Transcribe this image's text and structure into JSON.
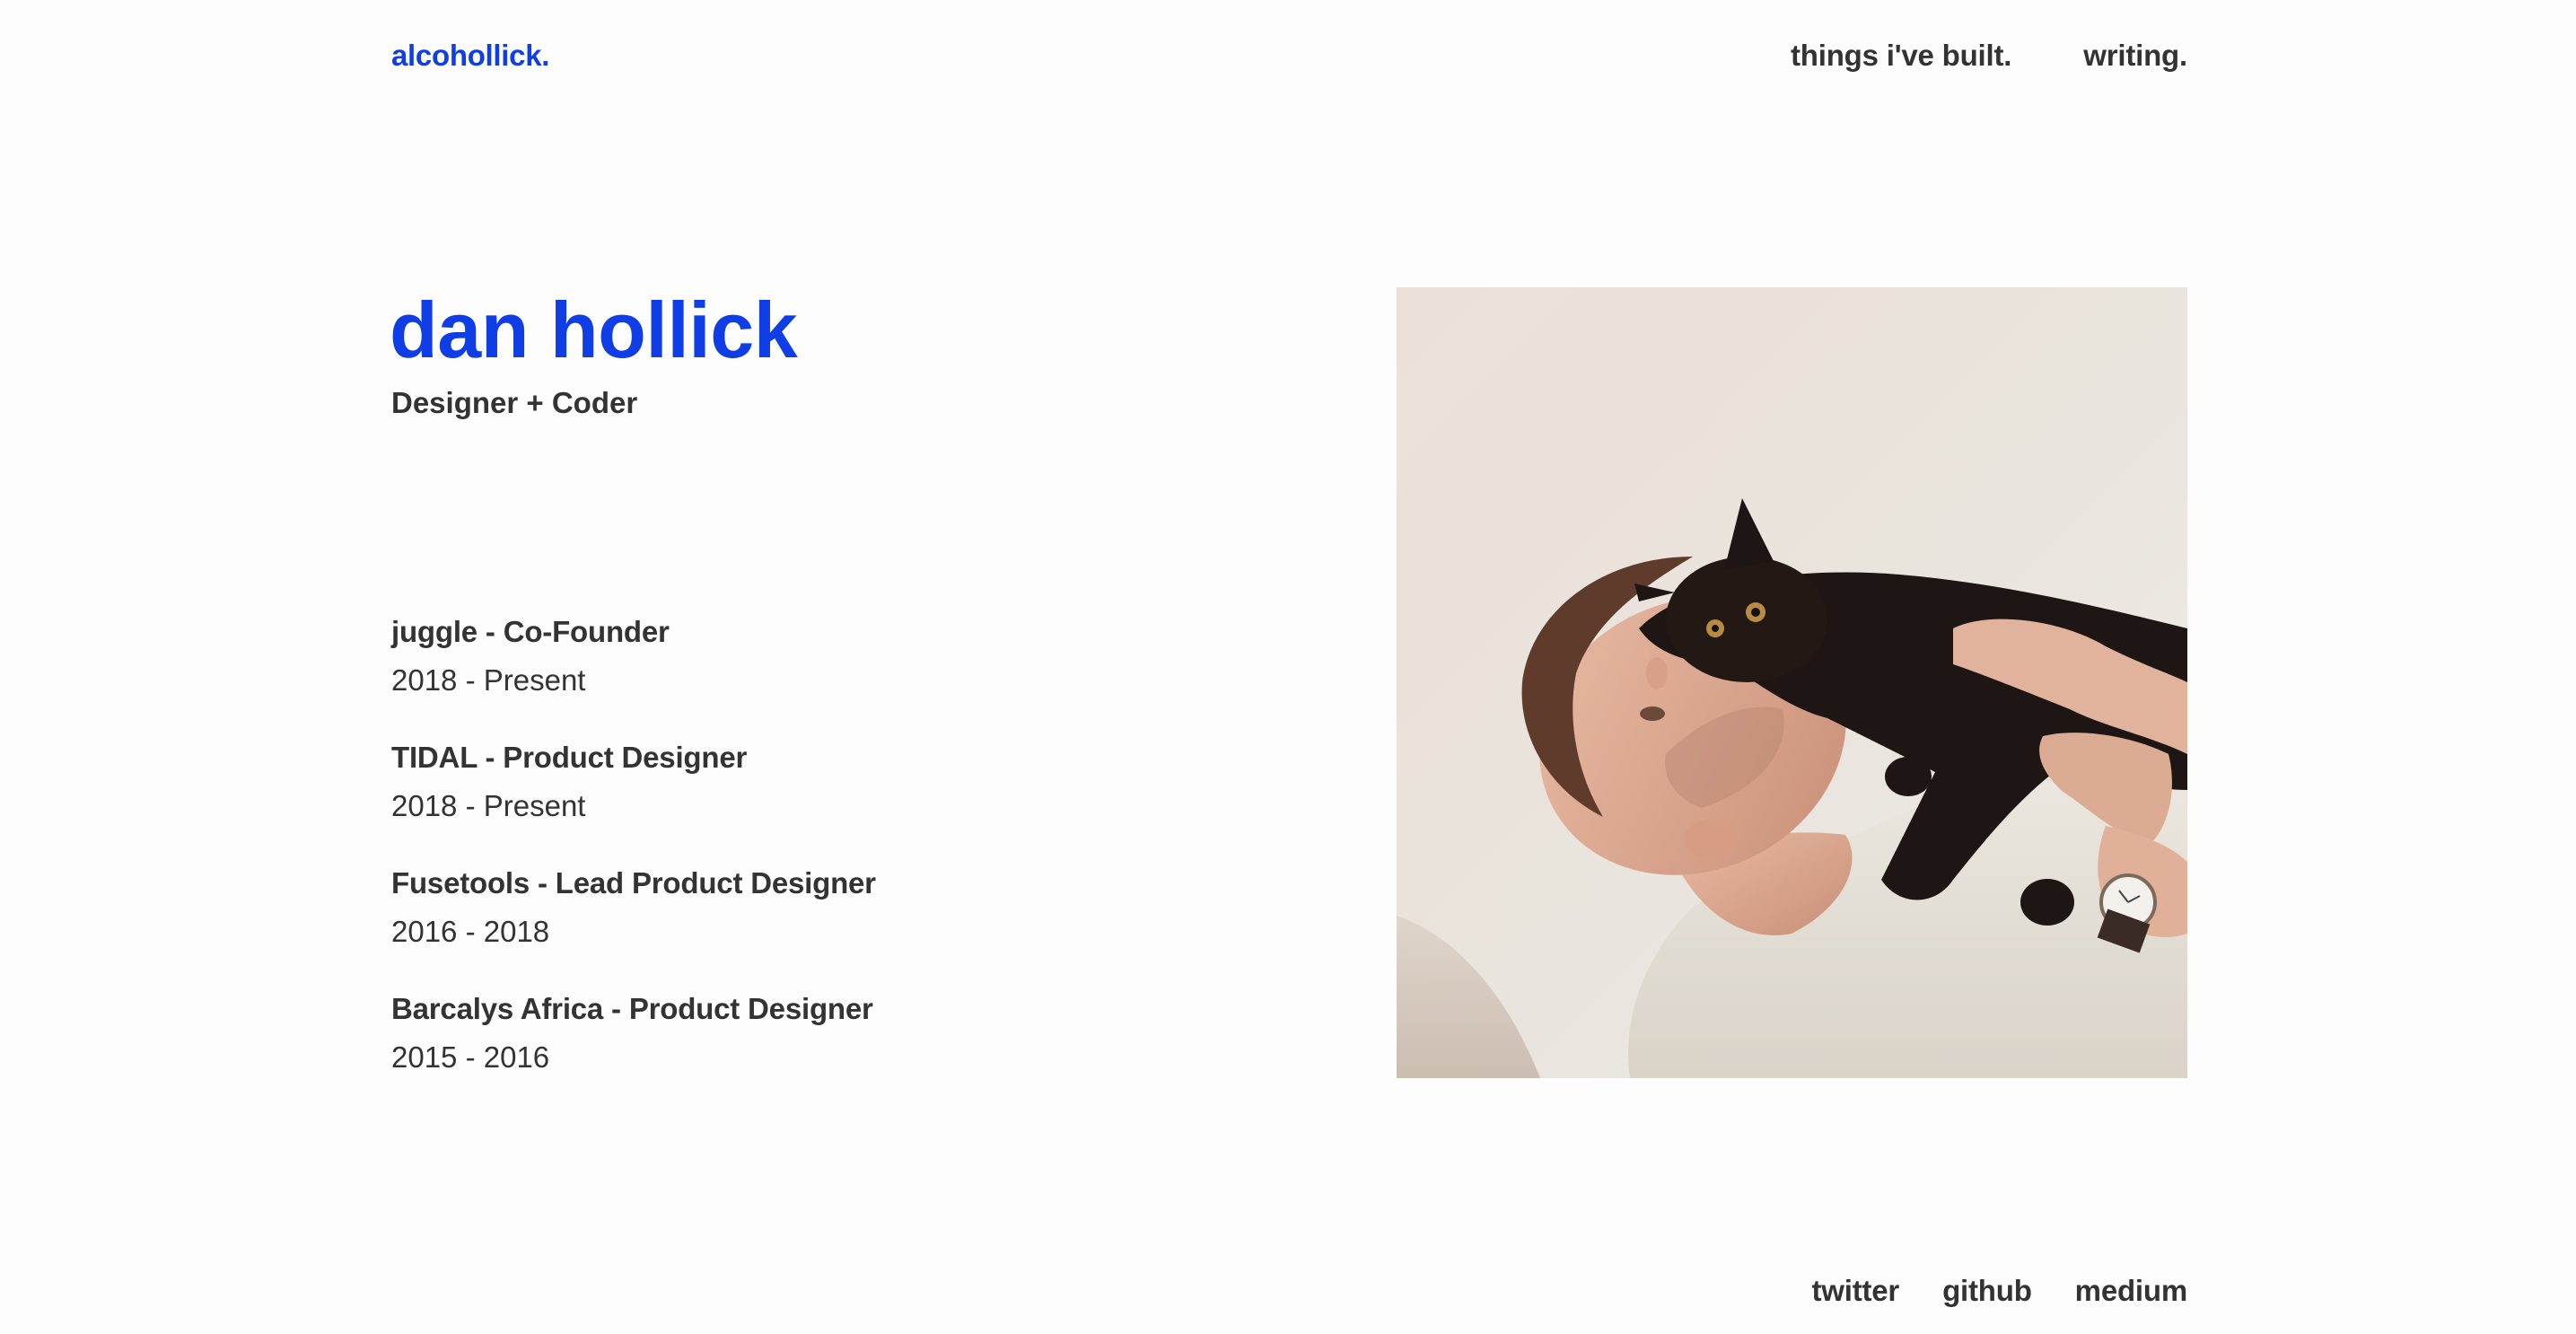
{
  "header": {
    "logo": "alcohollick.",
    "nav": [
      {
        "label": "things i've built."
      },
      {
        "label": "writing."
      }
    ]
  },
  "hero": {
    "name": "dan hollick",
    "tagline": "Designer + Coder",
    "photo_icon": "portrait-with-black-cat-image"
  },
  "jobs": [
    {
      "title": "juggle - Co-Founder",
      "dates": "2018 - Present"
    },
    {
      "title": "TIDAL - Product Designer",
      "dates": "2018 - Present"
    },
    {
      "title": "Fusetools - Lead Product Designer",
      "dates": "2016 - 2018"
    },
    {
      "title": "Barcalys Africa - Product Designer",
      "dates": "2015 - 2016"
    }
  ],
  "footer": {
    "links": [
      {
        "label": "twitter"
      },
      {
        "label": "github"
      },
      {
        "label": "medium"
      }
    ]
  },
  "colors": {
    "accent": "#0f3ee6",
    "text": "#333333",
    "background": "#fdfdfd"
  }
}
